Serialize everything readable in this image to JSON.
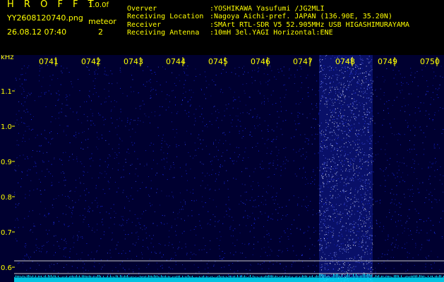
{
  "header": {
    "brand": "H R O F F T",
    "version": "1.0.0f",
    "filename": "YY2608120740.png",
    "datetime": "26.08.12 07:40",
    "meteor_label": "meteor",
    "meteor_count": "2"
  },
  "info": [
    {
      "label": "Overver",
      "value": ":YOSHIKAWA Yasufumi /JG2MLI"
    },
    {
      "label": "Receiving Location",
      "value": ":Nagoya Aichi-pref. JAPAN (136.90E, 35.20N)"
    },
    {
      "label": "Receiver",
      "value": ":SMArt RTL-SDR V5 52.905MHz USB HIGASHIMURAYAMA"
    },
    {
      "label": "Receiving Antenna",
      "value": ":10mH 3el.YAGI Horizontal:ENE"
    }
  ],
  "spectrogram": {
    "unit": "kHz",
    "time_labels": [
      "0741",
      "0742",
      "0743",
      "0744",
      "0745",
      "0746",
      "0747",
      "0748",
      "0749",
      "0750"
    ],
    "freq_labels": [
      "1.1",
      "1.0",
      "0.9",
      "0.8",
      "0.7",
      "0.6"
    ],
    "colors": {
      "background": "#000030",
      "noise": "#1a2cff",
      "burst": "#8ea4ff",
      "baseline": "#00e5ff",
      "label": "#ffff00",
      "hline": "#c8c8c8"
    }
  }
}
